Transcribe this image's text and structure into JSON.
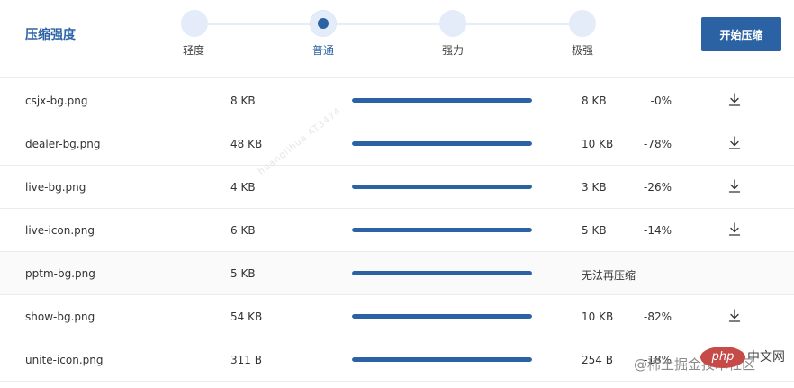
{
  "header": {
    "title": "压缩强度",
    "levels": [
      {
        "label": "轻度",
        "active": false
      },
      {
        "label": "普通",
        "active": true
      },
      {
        "label": "强力",
        "active": false
      },
      {
        "label": "极强",
        "active": false
      }
    ],
    "start_button": "开始压缩"
  },
  "files": [
    {
      "name": "csjx-bg.png",
      "size": "8 KB",
      "progress": 1.0,
      "new_size": "8 KB",
      "ratio": "-0%",
      "status": "",
      "downloadable": true
    },
    {
      "name": "dealer-bg.png",
      "size": "48 KB",
      "progress": 1.0,
      "new_size": "10 KB",
      "ratio": "-78%",
      "status": "",
      "downloadable": true
    },
    {
      "name": "live-bg.png",
      "size": "4 KB",
      "progress": 1.0,
      "new_size": "3 KB",
      "ratio": "-26%",
      "status": "",
      "downloadable": true
    },
    {
      "name": "live-icon.png",
      "size": "6 KB",
      "progress": 1.0,
      "new_size": "5 KB",
      "ratio": "-14%",
      "status": "",
      "downloadable": true
    },
    {
      "name": "pptm-bg.png",
      "size": "5 KB",
      "progress": 1.0,
      "new_size": "",
      "ratio": "",
      "status": "无法再压缩",
      "downloadable": false
    },
    {
      "name": "show-bg.png",
      "size": "54 KB",
      "progress": 1.0,
      "new_size": "10 KB",
      "ratio": "-82%",
      "status": "",
      "downloadable": true
    },
    {
      "name": "unite-icon.png",
      "size": "311 B",
      "progress": 1.0,
      "new_size": "254 B",
      "ratio": "-18%",
      "status": "",
      "downloadable": false
    }
  ],
  "icons": {
    "download": "download-icon"
  },
  "colors": {
    "accent": "#2a62a3",
    "track": "#e3ecf8"
  },
  "watermark": {
    "diagonal": "huanglihua  AT3474",
    "site": "@稀土掘金技术社区",
    "badge": "php",
    "badge_text": "中文网"
  }
}
